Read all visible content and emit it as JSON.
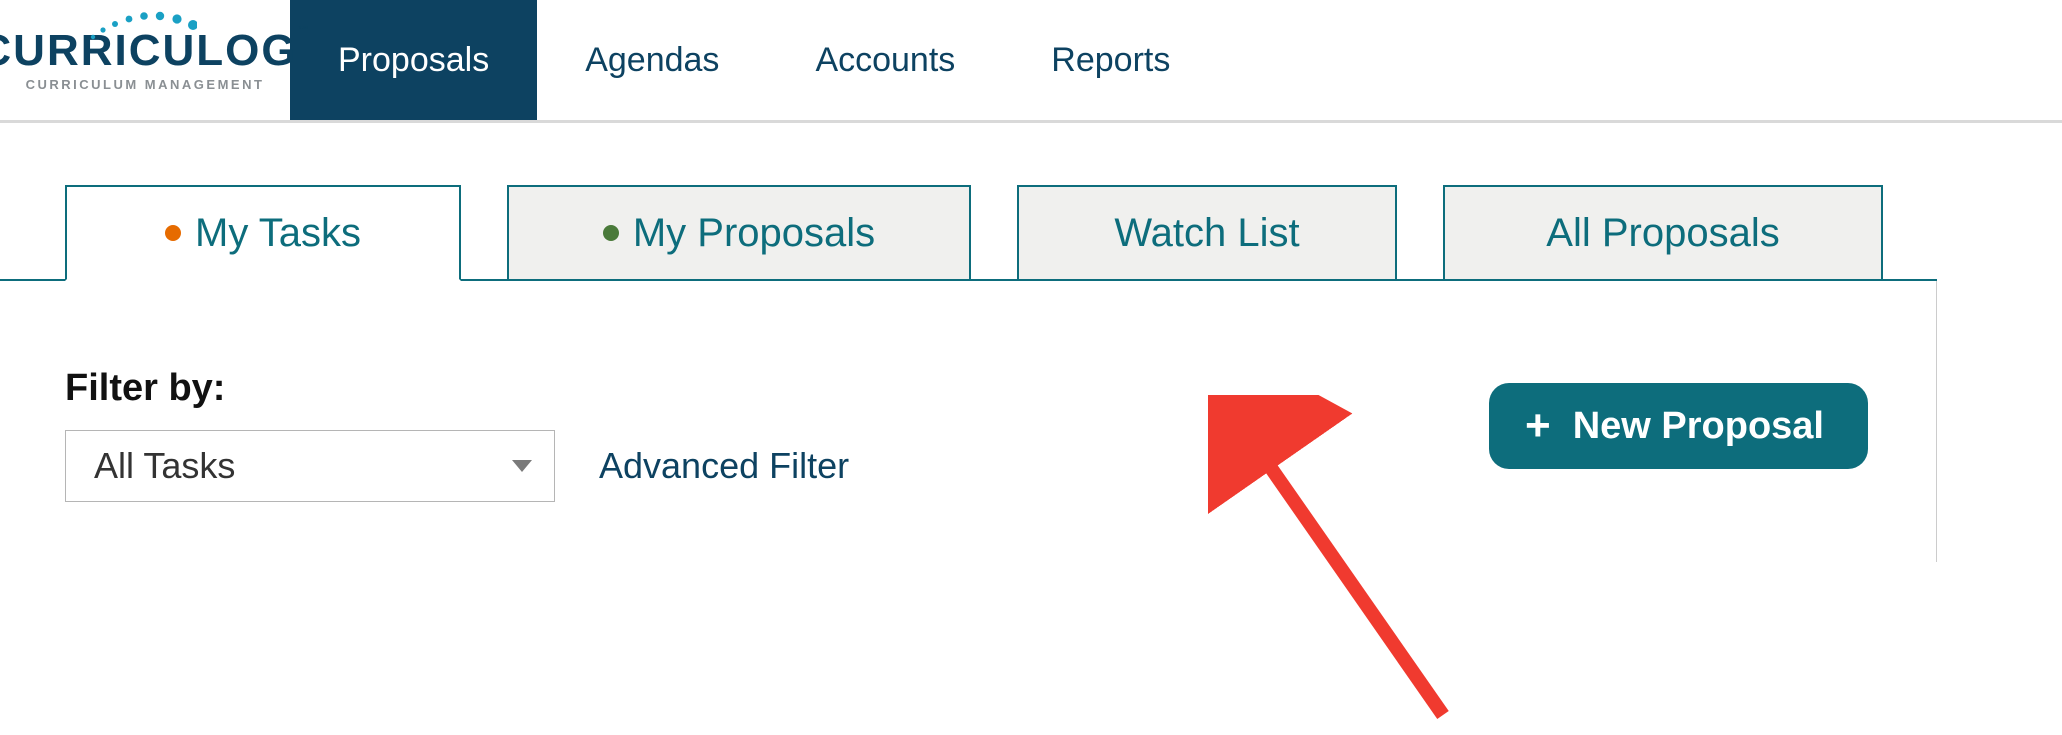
{
  "brand": {
    "name": "CURRICULOG",
    "tagline": "CURRICULUM MANAGEMENT",
    "tm": "™"
  },
  "nav": {
    "items": [
      {
        "label": "Proposals",
        "active": true
      },
      {
        "label": "Agendas",
        "active": false
      },
      {
        "label": "Accounts",
        "active": false
      },
      {
        "label": "Reports",
        "active": false
      }
    ]
  },
  "tabs": {
    "items": [
      {
        "label": "My Tasks",
        "dot": "orange",
        "active": true
      },
      {
        "label": "My Proposals",
        "dot": "green",
        "active": false
      },
      {
        "label": "Watch List",
        "dot": null,
        "active": false
      },
      {
        "label": "All Proposals",
        "dot": null,
        "active": false
      }
    ]
  },
  "filter": {
    "label": "Filter by:",
    "selected": "All Tasks",
    "advanced_label": "Advanced Filter"
  },
  "actions": {
    "new_proposal": "New Proposal"
  },
  "colors": {
    "brand_dark": "#0d4261",
    "teal": "#0d6d7c",
    "dot_orange": "#e66b00",
    "dot_green": "#4a7a3a",
    "arrow_red": "#f03a2f"
  }
}
